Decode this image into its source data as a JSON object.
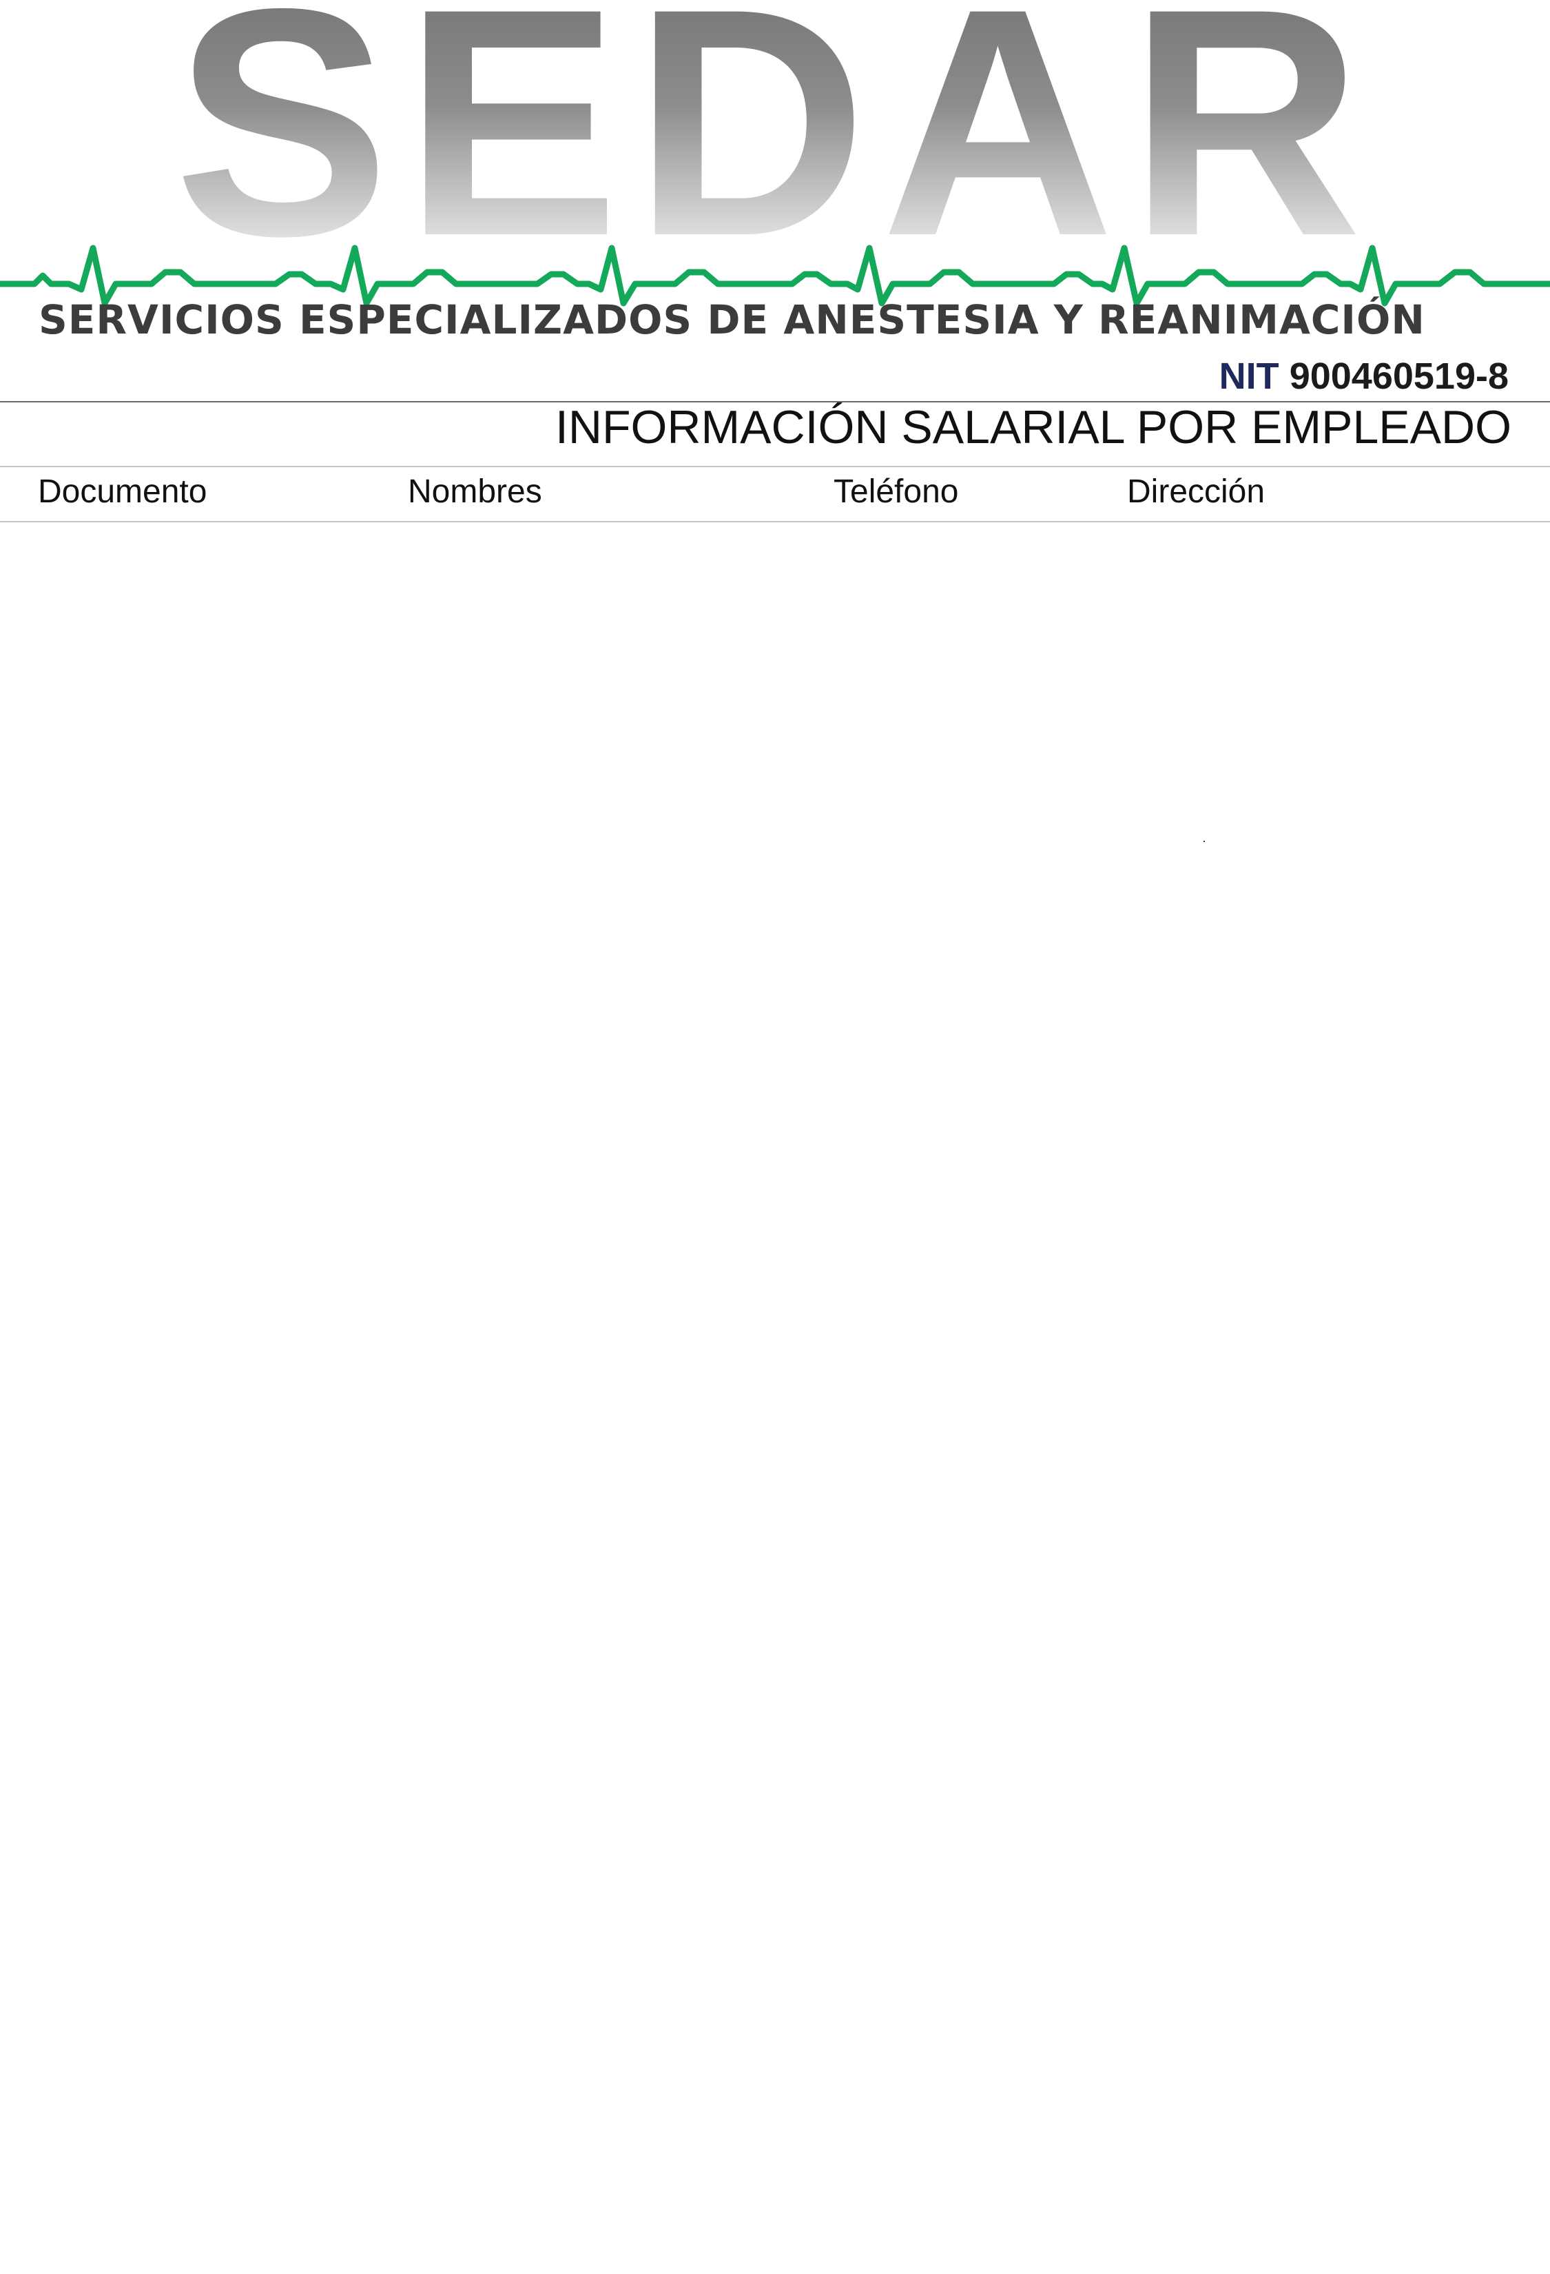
{
  "header": {
    "logo_text": "SEDAR",
    "company_name": "SERVICIOS ESPECIALIZADOS DE ANESTESIA Y REANIMACIÓN",
    "nit_label": "NIT",
    "nit_number": "900460519-8",
    "colors": {
      "logo_gray": "#8a8a8a",
      "ecg_green": "#14a85a",
      "company_text": "#3c3c3c",
      "nit_label": "#1f2a5c"
    }
  },
  "report": {
    "title": "INFORMACIÓN SALARIAL POR EMPLEADO"
  },
  "table": {
    "columns": [
      "Documento",
      "Nombres",
      "Teléfono",
      "Dirección"
    ],
    "rows": []
  }
}
